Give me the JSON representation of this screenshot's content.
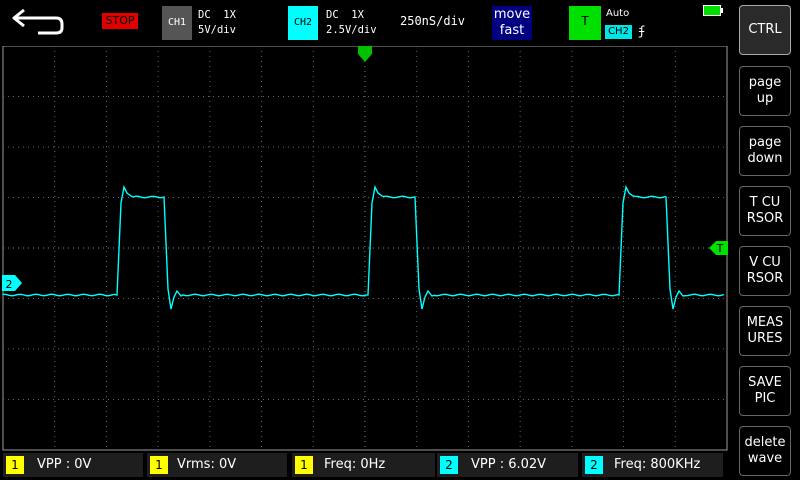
{
  "topbar": {
    "back_icon": "return-arrow-icon",
    "run_state": "STOP",
    "ch1": {
      "label": "CH1",
      "coupling": "DC  1X",
      "scale": "5V/div"
    },
    "ch2": {
      "label": "CH2",
      "coupling": "DC  1X",
      "scale": "2.5V/div",
      "color": "#00ffff"
    },
    "timebase": "250nS/div",
    "move": {
      "line1": "move",
      "line2": "fast"
    },
    "trigger": {
      "label": "T",
      "mode": "Auto",
      "source": "CH2",
      "edge": "ʄ"
    },
    "battery_icon": "battery-icon"
  },
  "markers": {
    "trigger_pos": "T",
    "ch2_ref": "2"
  },
  "side_buttons": [
    {
      "id": "ctrl",
      "label": "CTRL"
    },
    {
      "id": "page-up",
      "label": "page\nup"
    },
    {
      "id": "page-down",
      "label": "page\ndown"
    },
    {
      "id": "t-cursor",
      "label": "T CU\nRSOR"
    },
    {
      "id": "v-cursor",
      "label": "V CU\nRSOR"
    },
    {
      "id": "measures",
      "label": "MEAS\nURES"
    },
    {
      "id": "save-pic",
      "label": "SAVE\nPIC"
    },
    {
      "id": "delete-wave",
      "label": "delete\nwave"
    }
  ],
  "measurements": [
    {
      "ch": "1",
      "text": "VPP : 0V"
    },
    {
      "ch": "1",
      "text": "Vrms: 0V"
    },
    {
      "ch": "1",
      "text": "Freq: 0Hz"
    },
    {
      "ch": "2",
      "text": "VPP : 6.02V"
    },
    {
      "ch": "2",
      "text": "Freq: 800KHz"
    }
  ],
  "colors": {
    "ch1": "#ffff00",
    "ch2": "#00ffff",
    "trigger": "#00e000",
    "stop": "#e00000"
  }
}
